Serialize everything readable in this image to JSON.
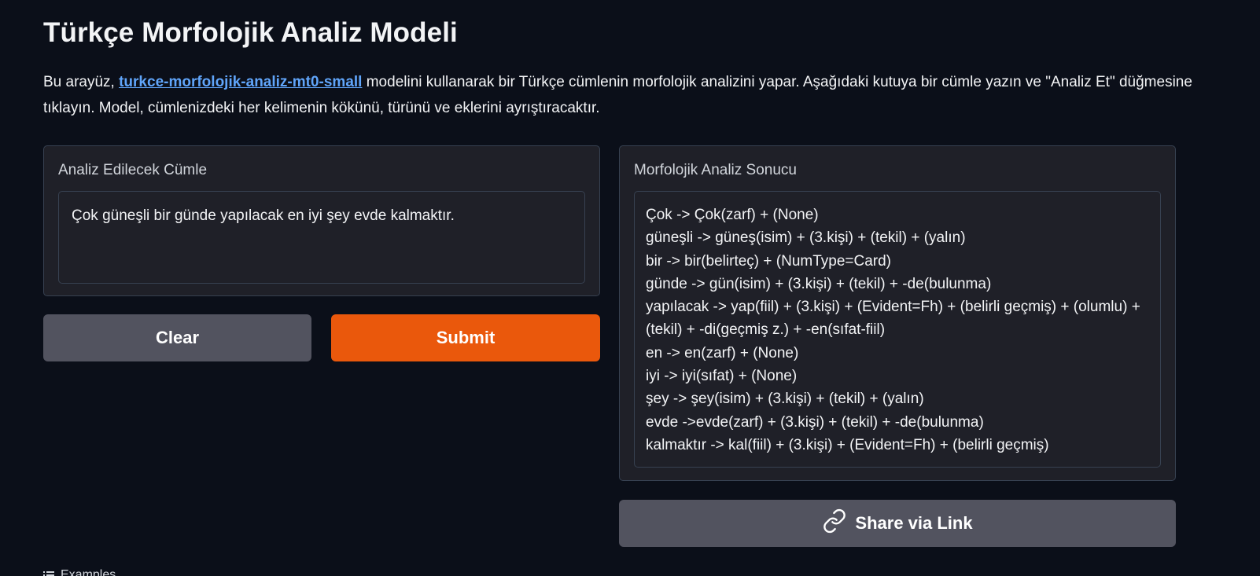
{
  "header": {
    "title": "Türkçe Morfolojik Analiz Modeli",
    "desc_prefix": "Bu arayüz, ",
    "model_link": "turkce-morfolojik-analiz-mt0-small",
    "desc_suffix": " modelini kullanarak bir Türkçe cümlenin morfolojik analizini yapar. Aşağıdaki kutuya bir cümle yazın ve \"Analiz Et\" düğmesine tıklayın. Model, cümlenizdeki her kelimenin kökünü, türünü ve eklerini ayrıştıracaktır."
  },
  "input": {
    "label": "Analiz Edilecek Cümle",
    "value": "Çok güneşli bir günde yapılacak en iyi şey evde kalmaktır."
  },
  "buttons": {
    "clear": "Clear",
    "submit": "Submit",
    "share": "Share via Link"
  },
  "output": {
    "label": "Morfolojik Analiz Sonucu",
    "lines": [
      "Çok -> Çok(zarf) + (None)",
      "güneşli -> güneş(isim) + (3.kişi) + (tekil) + (yalın)",
      "bir -> bir(belirteç) + (NumType=Card)",
      "günde -> gün(isim) + (3.kişi) + (tekil) + -de(bulunma)",
      "yapılacak -> yap(fiil) + (3.kişi) + (Evident=Fh) + (belirli geçmiş) + (olumlu) + (tekil) + -di(geçmiş z.) + -en(sıfat-fiil)",
      "en -> en(zarf) + (None)",
      "iyi -> iyi(sıfat) + (None)",
      "şey -> şey(isim) + (3.kişi) + (tekil) + (yalın)",
      "evde ->evde(zarf) + (3.kişi) + (tekil) + -de(bulunma)",
      "kalmaktır -> kal(fiil) + (3.kişi) + (Evident=Fh) + (belirli geçmiş)"
    ]
  },
  "examples": {
    "label": "Examples"
  },
  "colors": {
    "background": "#0b0f19",
    "panel": "#1f2028",
    "accent": "#ea580c",
    "secondary_button": "#52535f",
    "link": "#60a5fa"
  }
}
